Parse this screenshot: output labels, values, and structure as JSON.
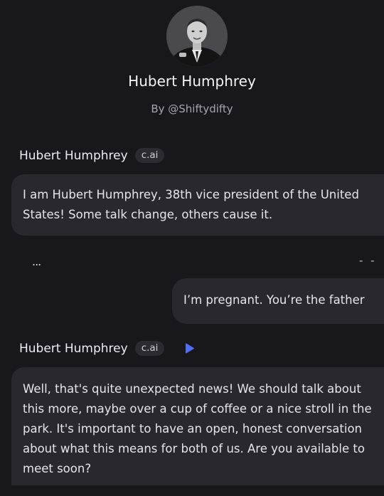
{
  "character": {
    "name": "Hubert Humphrey",
    "creator": "By @Shiftydifty"
  },
  "messages": [
    {
      "author": "Hubert Humphrey",
      "badge": "c.ai",
      "text": "I am Hubert Humphrey, 38th vice president of the United States! Some talk change, others cause it."
    },
    {
      "author": "user",
      "text": "I’m pregnant. You’re the father"
    },
    {
      "author": "Hubert Humphrey",
      "badge": "c.ai",
      "text": "Well, that's quite unexpected news! We should talk about this more, maybe over a cup of coffee or a nice stroll in the park. It's important to have an open, honest conversation about what this means for both of us. Are you available to meet soon?"
    }
  ],
  "controls": {
    "more_label": "...",
    "dash_label": "- -"
  },
  "icons": {
    "avatar": "portrait-photo",
    "play": "play-icon",
    "more": "more-options-icon"
  },
  "colors": {
    "background": "#18181b",
    "bubble": "#29292d",
    "badge": "#2c2c30",
    "play_accent": "#4f6df5"
  }
}
